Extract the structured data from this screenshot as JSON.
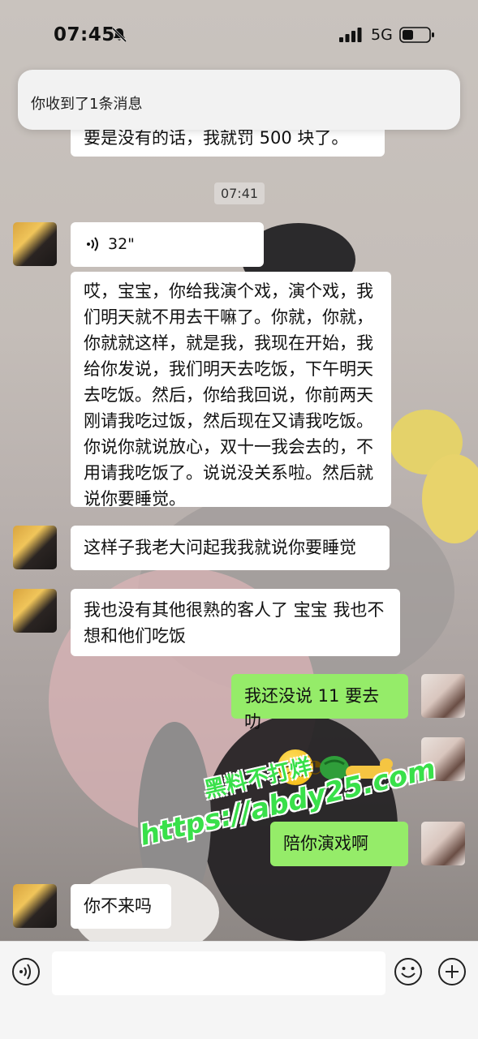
{
  "status_bar": {
    "time": "07:45",
    "network": "5G",
    "icons": [
      "bell-muted-icon",
      "signal-bars-icon",
      "battery-icon"
    ]
  },
  "notification": {
    "text": "你收到了1条消息"
  },
  "chat": {
    "partial_top_message": "要是没有的话，我就罚 500 块了。",
    "timestamp": "07:41",
    "voice_message": {
      "duration": "32\"",
      "icon": "voice-wave-icon"
    },
    "messages": [
      {
        "side": "left",
        "text": "哎，宝宝，你给我演个戏，演个戏，我们明天就不用去干嘛了。你就，你就，你就就这样，就是我，我现在开始，我给你发说，我们明天去吃饭，下午明天去吃饭。然后，你给我回说，你前两天刚请我吃过饭，然后现在又请我吃饭。你说你就说放心，双十一我会去的，不用请我吃饭了。说说没关系啦。然后就说你要睡觉。"
      },
      {
        "side": "left",
        "text": "这样子我老大问起我我就说你要睡觉"
      },
      {
        "side": "left",
        "text": "我也没有其他很熟的客人了 宝宝 我也不想和他们吃饭"
      },
      {
        "side": "right",
        "text": "我还没说 11 要去叻"
      },
      {
        "side": "right",
        "text": "",
        "emoji": [
          "sly-face-emoji",
          "sleeping-emoji"
        ]
      },
      {
        "side": "right",
        "text": "陪你演戏啊"
      },
      {
        "side": "left",
        "text": "你不来吗"
      }
    ],
    "watermark": {
      "line1": "黑料不打烊",
      "line2": "https://abdy25.com"
    }
  },
  "input_bar": {
    "placeholder": "",
    "icons": [
      "voice-input-icon",
      "emoji-icon",
      "plus-icon"
    ]
  },
  "colors": {
    "sent_bubble": "#95ec69",
    "received_bubble": "#ffffff",
    "input_bar_bg": "#f5f5f5",
    "watermark": "#39e04a"
  }
}
